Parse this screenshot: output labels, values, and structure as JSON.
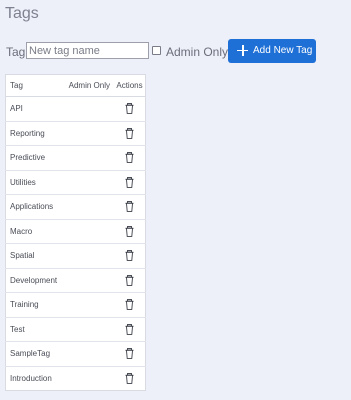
{
  "page": {
    "title": "Tags"
  },
  "toolbar": {
    "tag_label": "Tag:",
    "tag_input_placeholder": "New tag name",
    "tag_input_value": "",
    "admin_only_label": "Admin Only",
    "admin_only_checked": false,
    "add_button_label": "Add New Tag",
    "add_button_icon": "plus-icon",
    "accent_color": "#1e6fd6"
  },
  "table": {
    "headers": {
      "tag": "Tag",
      "admin_only": "Admin Only",
      "actions": "Actions"
    },
    "action_icon": "trash-icon",
    "rows": [
      {
        "tag": "API"
      },
      {
        "tag": "Reporting"
      },
      {
        "tag": "Predictive"
      },
      {
        "tag": "Utilities"
      },
      {
        "tag": "Applications"
      },
      {
        "tag": "Macro"
      },
      {
        "tag": "Spatial"
      },
      {
        "tag": "Development"
      },
      {
        "tag": "Training"
      },
      {
        "tag": "Test"
      },
      {
        "tag": "SampleTag"
      },
      {
        "tag": "Introduction"
      }
    ]
  }
}
